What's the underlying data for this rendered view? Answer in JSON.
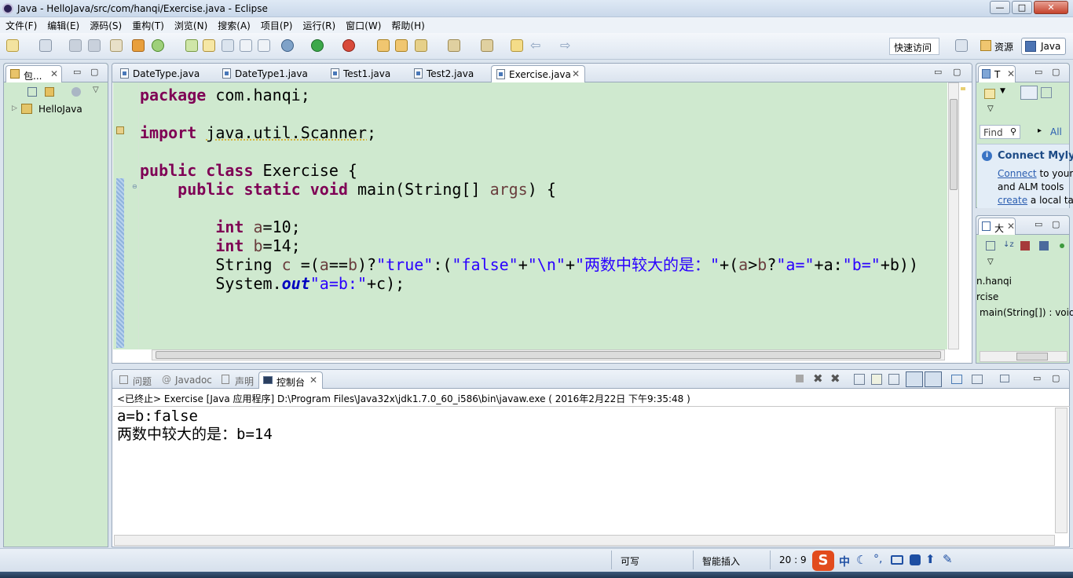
{
  "window": {
    "title": "Java - HelloJava/src/com/hanqi/Exercise.java - Eclipse",
    "min": "—",
    "max": "□",
    "close": "✕"
  },
  "menu": [
    "文件(F)",
    "编辑(E)",
    "源码(S)",
    "重构(T)",
    "浏览(N)",
    "搜索(A)",
    "项目(P)",
    "运行(R)",
    "窗口(W)",
    "帮助(H)"
  ],
  "toolbar": {
    "quick_access": "快速访问",
    "perspective_resource": "资源",
    "perspective_java": "Java"
  },
  "package_explorer": {
    "tab": "包...",
    "project": "HelloJava"
  },
  "editor": {
    "tabs": [
      "DateType.java",
      "DateType1.java",
      "Test1.java",
      "Test2.java",
      "Exercise.java"
    ],
    "active_tab": "Exercise.java",
    "tokens": {
      "package": "package",
      "import": "import",
      "public": "public",
      "class": "class",
      "static": "static",
      "void": "void",
      "int": "int",
      "pkg": " com.hanqi;",
      "imp_a": " ",
      "imp_b": "java.util.Scanner",
      ";": ";",
      "cls": " Exercise {",
      "main_a": " main(String[] ",
      "args": "args",
      ") {": ") {",
      "a": "a",
      "b": "b",
      "c": "c",
      "eq10": "=10;",
      "eq14": "=14;",
      "string": "String ",
      "eqp": " =(",
      "eqeq": "==",
      "qmark": ")?",
      "s_true": "\"true\"",
      "colonp": ":(",
      "s_false": "\"false\"",
      "plus": "+",
      "s_nl": "\"\\n\"",
      "s_msg": "\"两数中较大的是：\"",
      "plusp": "+(",
      "gt": ">",
      "q2": "?",
      "s_aeq": "\"a=\"",
      "pa": "+a:",
      "s_beq": "\"b=\"",
      "pb": "+b))",
      "sys": "System.",
      "out": "out",
      ".println(": ".println(",
      "s_ab": "\"a=b:\"",
      "plusc": "+c);"
    }
  },
  "type_hierarchy": {
    "tab": "T",
    "find_placeholder": "Find",
    "all": "All"
  },
  "mylyn": {
    "title": "Connect Mylyn",
    "link": "Connect",
    "text1": " to your",
    "text2": "and ALM tools",
    "link2": "create",
    "text3": " a local ta"
  },
  "outline": {
    "tab": "大",
    "items": [
      "n.hanqi",
      "rcise",
      "main(String[]) : void"
    ]
  },
  "console": {
    "tabs": [
      "问题",
      "Javadoc",
      "声明",
      "控制台"
    ],
    "header": "<已终止> Exercise [Java 应用程序] D:\\Program Files\\Java32x\\jdk1.7.0_60_i586\\bin\\javaw.exe ( 2016年2月22日 下午9:35:48 )",
    "lines": [
      "a=b:false",
      "两数中较大的是：b=14"
    ]
  },
  "status": {
    "writable": "可写",
    "insert_mode": "智能插入",
    "position": "20 : 9"
  },
  "ime": {
    "logo": "S",
    "mode": "中"
  }
}
